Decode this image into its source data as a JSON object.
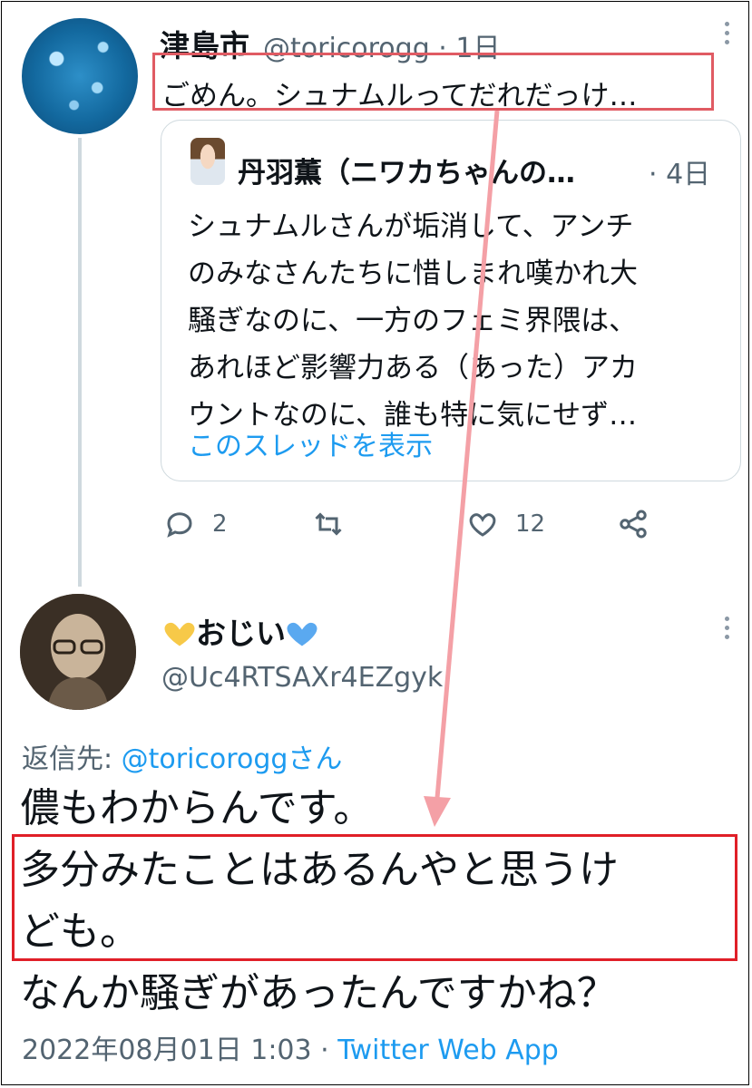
{
  "tweet1": {
    "display_name": "津島市",
    "handle_time": "@toricorogg · 1日",
    "text": "ごめん。シュナムルってだれだっけ…"
  },
  "quote": {
    "display_name": "丹羽薫（ニワカちゃんの…",
    "time": "· 4日",
    "lines": [
      "シュナムルさんが垢消して、アンチ",
      "のみなさんたちに惜しまれ嘆かれ大",
      "騒ぎなのに、一方のフェミ界隈は、",
      "あれほど影響力ある（あった）アカ",
      "ウントなのに、誰も特に気にせず…"
    ],
    "show_thread": "このスレッドを表示"
  },
  "actions": {
    "reply_count": "2",
    "retweet_count": "",
    "like_count": "12"
  },
  "tweet2": {
    "display_name": "おじい",
    "handle": "@Uc4RTSAXr4EZgyk",
    "reply_prefix": "返信先: ",
    "reply_mention": "@toricoroggさん",
    "lines": [
      "儂もわからんです。",
      "多分みたことはあるんやと思うけ",
      "ども。",
      "なんか騒ぎがあったんですかね？"
    ],
    "timestamp": "2022年08月01日 1:03 · ",
    "app": "Twitter Web App"
  },
  "colors": {
    "link_blue": "#1d9bf0",
    "secondary_text": "#536471",
    "highlight_red": "#e01f28",
    "arrow_pink": "#f4a0a6",
    "heart_yellow": "#f7c948",
    "heart_blue": "#5aa9f0"
  },
  "icons": [
    "more-icon",
    "reply-icon",
    "retweet-icon",
    "like-icon",
    "share-icon",
    "yellow-heart-icon",
    "blue-heart-icon"
  ]
}
